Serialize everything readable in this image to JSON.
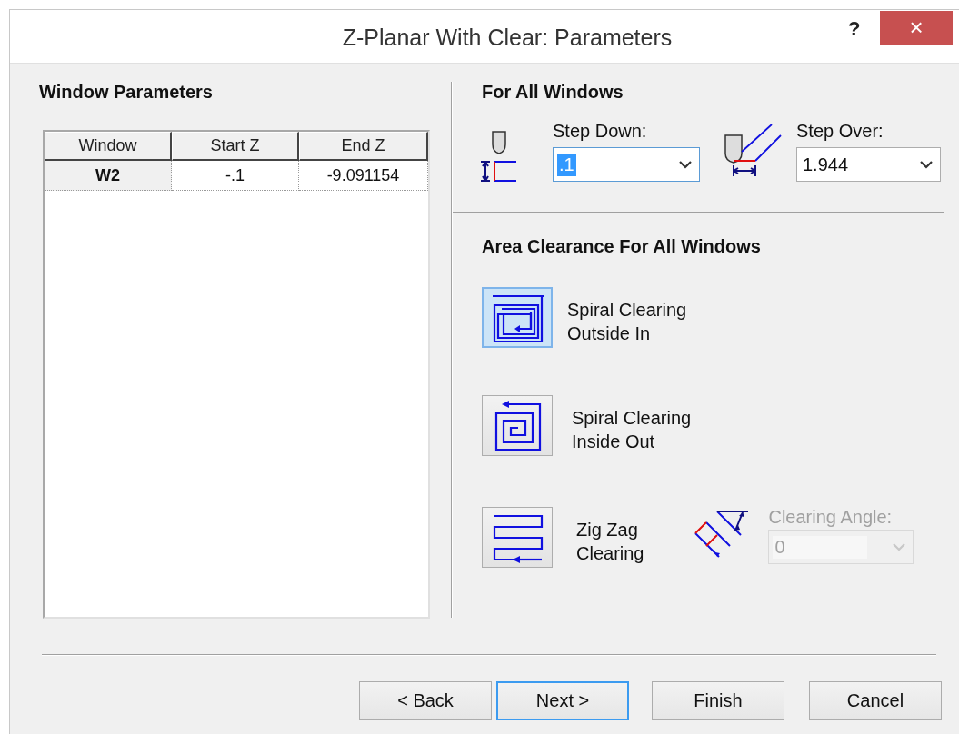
{
  "window": {
    "title": "Z-Planar With Clear: Parameters",
    "help": "?",
    "close": "×"
  },
  "window_parameters": {
    "heading": "Window Parameters",
    "table": {
      "columns": [
        "Window",
        "Start Z",
        "End Z"
      ],
      "rows": [
        {
          "cells": [
            "W2",
            "-.1",
            "-9.091154"
          ]
        }
      ]
    }
  },
  "for_all_windows": {
    "heading": "For All Windows",
    "fields": [
      {
        "kind": "step-down",
        "label": "Step Down:",
        "value": ".1",
        "focused": true
      },
      {
        "kind": "step-over",
        "label": "Step Over:",
        "value": "1.944",
        "focused": false
      }
    ]
  },
  "area_clearance": {
    "heading": "Area Clearance For All Windows",
    "options": [
      {
        "kind": "spiral-in",
        "label": "Spiral Clearing\nOutside In",
        "selected": true
      },
      {
        "kind": "spiral-out",
        "label": "Spiral Clearing\nInside Out",
        "selected": false
      },
      {
        "kind": "zigzag",
        "label": "Zig Zag\nClearing",
        "selected": false
      }
    ],
    "clearing_angle": {
      "label": "Clearing Angle:",
      "value": "0",
      "disabled": true
    }
  },
  "buttons": [
    {
      "label": "< Back",
      "focused": false
    },
    {
      "label": "Next >",
      "focused": true
    },
    {
      "label": "Finish",
      "focused": false
    },
    {
      "label": "Cancel",
      "focused": false
    }
  ]
}
